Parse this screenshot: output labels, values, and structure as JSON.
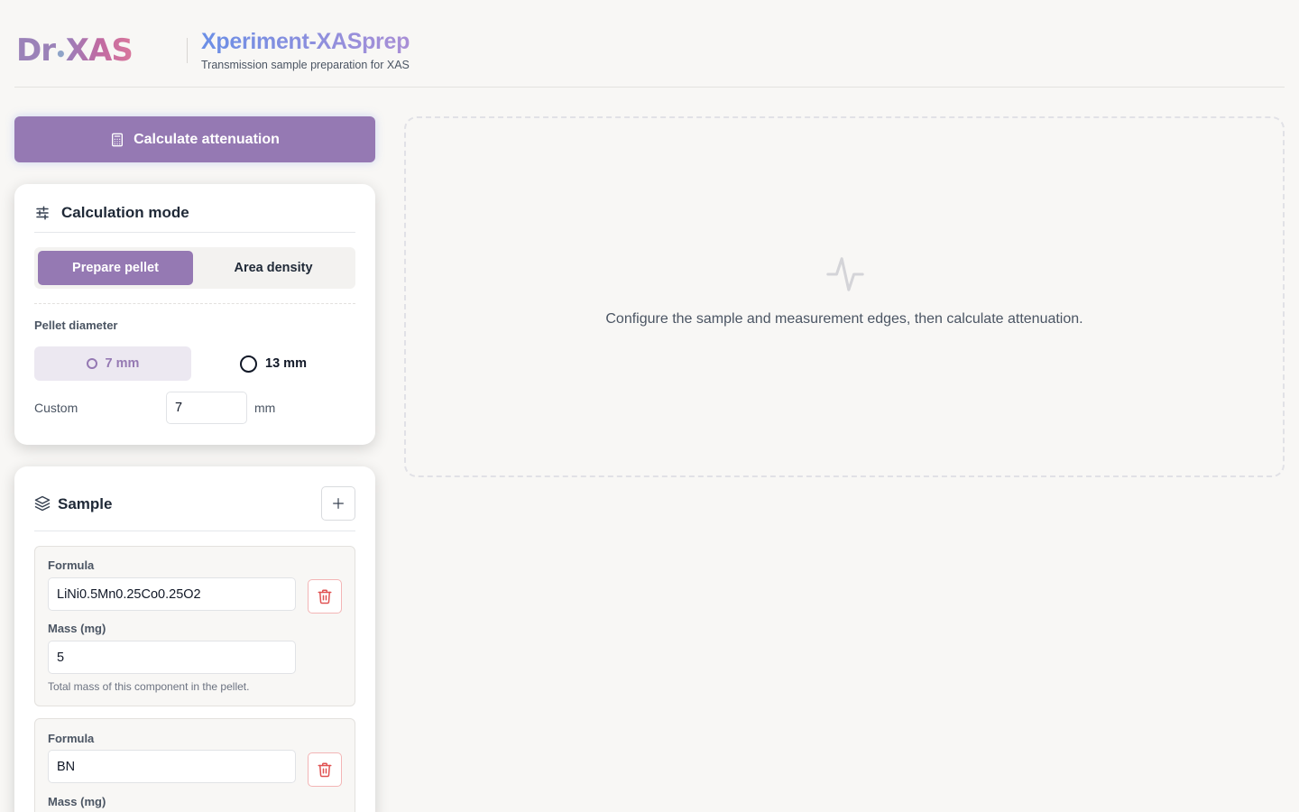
{
  "header": {
    "logo": {
      "dr": "Dr",
      "dot": "•",
      "xas": "XAS"
    },
    "title": "Xperiment-XASprep",
    "subtitle": "Transmission sample preparation for XAS"
  },
  "actions": {
    "calculate_label": "Calculate attenuation"
  },
  "calculation_mode": {
    "title": "Calculation mode",
    "modes": [
      {
        "label": "Prepare pellet",
        "active": true
      },
      {
        "label": "Area density",
        "active": false
      }
    ],
    "pellet_diameter": {
      "label": "Pellet diameter",
      "options": [
        {
          "label": "7 mm",
          "selected": true
        },
        {
          "label": "13 mm",
          "selected": false
        }
      ],
      "custom_label": "Custom",
      "custom_value": "7",
      "unit": "mm"
    }
  },
  "sample": {
    "title": "Sample",
    "components": [
      {
        "formula_label": "Formula",
        "formula": "LiNi0.5Mn0.25Co0.25O2",
        "mass_label": "Mass (mg)",
        "mass": "5",
        "hint": "Total mass of this component in the pellet."
      },
      {
        "formula_label": "Formula",
        "formula": "BN",
        "mass_label": "Mass (mg)",
        "mass": "",
        "hint": ""
      }
    ]
  },
  "results": {
    "empty_message": "Configure the sample and measurement edges, then calculate attenuation."
  },
  "colors": {
    "accent": "#9579b3",
    "accent_light": "#ece8f1",
    "danger": "#e05252",
    "title_gradient_start": "#6b8fe6",
    "title_gradient_end": "#a98fd6",
    "background": "#f8f7f5"
  },
  "icons": {
    "calculate": "calculator-icon",
    "mode": "sliders-icon",
    "sample": "layers-icon",
    "add": "plus-icon",
    "delete": "trash-icon",
    "results": "activity-icon"
  }
}
